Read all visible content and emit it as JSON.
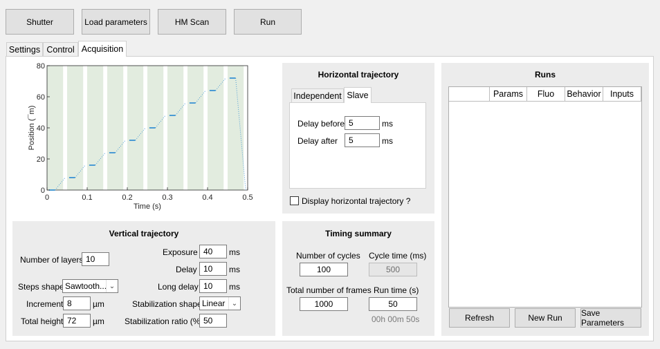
{
  "toolbar": {
    "shutter": "Shutter",
    "load_parameters": "Load parameters",
    "hm_scan": "HM Scan",
    "run": "Run"
  },
  "tabs": [
    "Settings",
    "Control",
    "Acquisition"
  ],
  "chart_data": {
    "type": "line",
    "xlabel": "Time (s)",
    "ylabel": "Position (¯m)",
    "xlim": [
      0,
      0.5
    ],
    "ylim": [
      0,
      80
    ],
    "x_ticks": [
      "0",
      "0.1",
      "0.2",
      "0.3",
      "0.4",
      "0.5"
    ],
    "y_ticks": [
      "0",
      "20",
      "40",
      "60",
      "80"
    ],
    "layer_positions": [
      0,
      8,
      16,
      24,
      32,
      40,
      48,
      56,
      64,
      72
    ],
    "cycle_period": 0.05,
    "shaded_bands": [
      [
        0,
        0.04
      ],
      [
        0.05,
        0.09
      ],
      [
        0.1,
        0.14
      ],
      [
        0.15,
        0.19
      ],
      [
        0.2,
        0.24
      ],
      [
        0.25,
        0.29
      ],
      [
        0.3,
        0.34
      ],
      [
        0.35,
        0.39
      ],
      [
        0.4,
        0.44
      ],
      [
        0.45,
        0.49
      ]
    ],
    "line_color": "#4a9bd4",
    "band_color": "#e2ecdf"
  },
  "vertical": {
    "title": "Vertical trajectory",
    "num_layers_label": "Number of layers",
    "num_layers": "10",
    "steps_shape_label": "Steps shape",
    "steps_shape": "Sawtooth...",
    "increment_label": "Increment",
    "increment": "8",
    "total_height_label": "Total height",
    "total_height": "72",
    "unit_um": "µm",
    "exposure_label": "Exposure",
    "exposure": "40",
    "delay_label": "Delay",
    "delay": "10",
    "long_delay_label": "Long delay",
    "long_delay": "10",
    "stab_shape_label": "Stabilization shape",
    "stab_shape": "Linear",
    "stab_ratio_label": "Stabilization ratio (%)",
    "stab_ratio": "50",
    "unit_ms": "ms"
  },
  "horizontal": {
    "title": "Horizontal trajectory",
    "tab_independent": "Independent",
    "tab_slave": "Slave",
    "delay_before_label": "Delay before",
    "delay_before": "5",
    "delay_after_label": "Delay after",
    "delay_after": "5",
    "unit_ms": "ms",
    "display_label": "Display horizontal trajectory ?"
  },
  "timing": {
    "title": "Timing summary",
    "num_cycles_label": "Number of cycles",
    "num_cycles": "100",
    "cycle_time_label": "Cycle time (ms)",
    "cycle_time": "500",
    "total_frames_label": "Total number of frames",
    "total_frames": "1000",
    "run_time_label": "Run time (s)",
    "run_time": "50",
    "run_time_formatted": "00h 00m 50s"
  },
  "runs": {
    "title": "Runs",
    "columns": [
      "",
      "Params",
      "Fluo",
      "Behavior",
      "Inputs"
    ],
    "refresh": "Refresh",
    "new_run": "New Run",
    "save_parameters": "Save Parameters"
  }
}
